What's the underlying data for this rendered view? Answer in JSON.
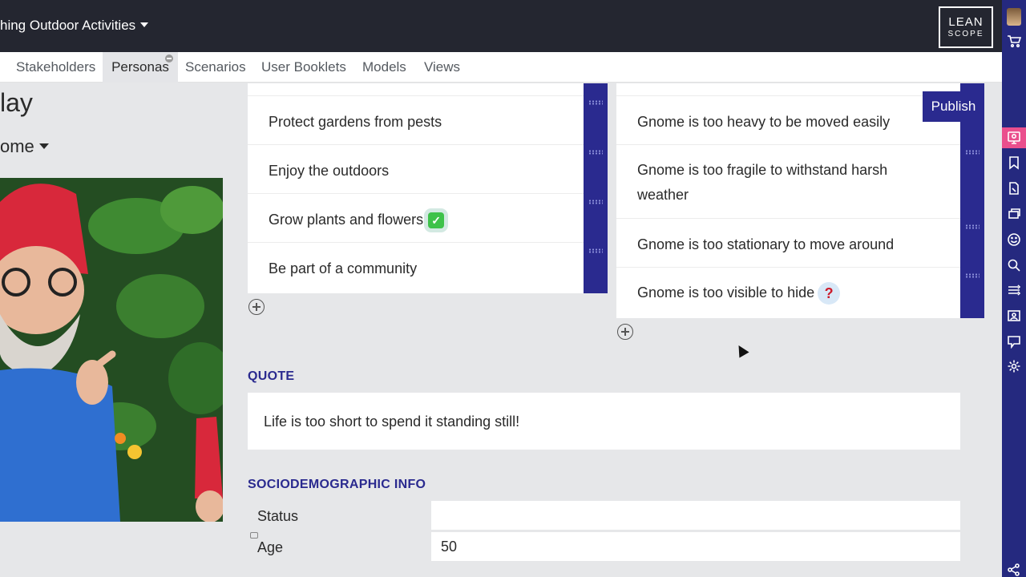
{
  "header": {
    "project_title": "hing Outdoor Activities",
    "logo_line1": "LEAN",
    "logo_line2": "SCOPE"
  },
  "tabs": [
    {
      "label": "Stakeholders",
      "active": false
    },
    {
      "label": "Personas",
      "active": true
    },
    {
      "label": "Scenarios",
      "active": false
    },
    {
      "label": "User Booklets",
      "active": false
    },
    {
      "label": "Models",
      "active": false
    },
    {
      "label": "Views",
      "active": false
    }
  ],
  "persona": {
    "name": "lay",
    "role": "ome"
  },
  "goals": [
    "Protect gardens from pests",
    "Enjoy the outdoors",
    "Grow plants and flowers",
    "Be part of a community"
  ],
  "pain_points": [
    "Gnome is too heavy to be moved easily",
    "Gnome is too fragile to withstand harsh weather",
    "Gnome is too stationary to move around",
    "Gnome is too visible to hide"
  ],
  "emoji": {
    "check": "✓",
    "question": "?"
  },
  "publish_label": "Publish",
  "quote": {
    "label": "QUOTE",
    "text": "Life is too short to spend it standing still!"
  },
  "sociodemographic": {
    "label": "SOCIODEMOGRAPHIC INFO",
    "fields": [
      {
        "label": "Status",
        "value": ""
      },
      {
        "label": "Age",
        "value": "50"
      }
    ]
  },
  "right_rail_icons": [
    "persona-icon",
    "bookmark-icon",
    "document-icon",
    "layers-icon",
    "smiley-icon",
    "search-icon",
    "flow-icon",
    "contact-card-icon",
    "presentation-icon",
    "gear-icon"
  ],
  "colors": {
    "header_bg": "#242630",
    "accent_navy": "#2a2a8f",
    "rail_bg": "#25297f",
    "active_pink": "#ea4f8d"
  }
}
